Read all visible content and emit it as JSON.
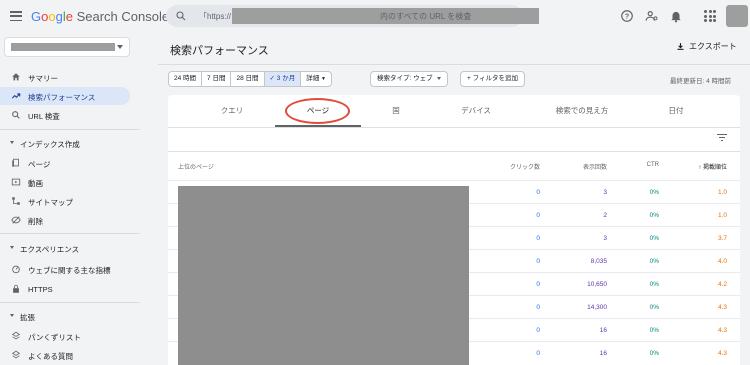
{
  "app": {
    "brand_google": "Google",
    "brand_product": "Search Console"
  },
  "search": {
    "prefix": "「https://",
    "suffix": "内のすべての URL を検査"
  },
  "sidebar": {
    "items": [
      {
        "label": "サマリー",
        "icon": "home-icon"
      },
      {
        "label": "検索パフォーマンス",
        "icon": "trending-icon",
        "active": true
      },
      {
        "label": "URL 検査",
        "icon": "search-icon"
      }
    ],
    "section_index": {
      "title": "インデックス作成",
      "items": [
        {
          "label": "ページ",
          "icon": "pages-icon"
        },
        {
          "label": "動画",
          "icon": "video-icon"
        },
        {
          "label": "サイトマップ",
          "icon": "sitemap-icon"
        },
        {
          "label": "削除",
          "icon": "removal-icon"
        }
      ]
    },
    "section_experience": {
      "title": "エクスペリエンス",
      "items": [
        {
          "label": "ウェブに関する主な指標",
          "icon": "vitals-icon"
        },
        {
          "label": "HTTPS",
          "icon": "lock-icon"
        }
      ]
    },
    "section_enhancements": {
      "title": "拡張",
      "items": [
        {
          "label": "パンくずリスト",
          "icon": "breadcrumb-icon"
        },
        {
          "label": "よくある質問",
          "icon": "faq-icon"
        }
      ]
    }
  },
  "main": {
    "title": "検索パフォーマンス",
    "export_label": "エクスポート",
    "date_options": [
      "24 時間",
      "7 日間",
      "28 日間",
      "3 か月",
      "詳細"
    ],
    "selected_date": "3 か月",
    "search_type_label": "検索タイプ: ウェブ",
    "add_filter_label": "+ フィルタを追加",
    "last_updated": "最終更新日: 4 時間前",
    "tabs": [
      "クエリ",
      "ページ",
      "国",
      "デバイス",
      "検索での見え方",
      "日付"
    ],
    "active_tab": "ページ",
    "table": {
      "headers": {
        "page": "上位のページ",
        "clicks": "クリック数",
        "impressions": "表示回数",
        "ctr": "CTR",
        "position": "掲載順位"
      },
      "sort_column": "掲載順位",
      "rows": [
        {
          "clicks": "0",
          "impressions": "3",
          "ctr": "0%",
          "position": "1.0"
        },
        {
          "clicks": "0",
          "impressions": "2",
          "ctr": "0%",
          "position": "1.0"
        },
        {
          "clicks": "0",
          "impressions": "3",
          "ctr": "0%",
          "position": "3.7"
        },
        {
          "clicks": "0",
          "impressions": "8,035",
          "ctr": "0%",
          "position": "4.0"
        },
        {
          "clicks": "0",
          "impressions": "10,650",
          "ctr": "0%",
          "position": "4.2"
        },
        {
          "clicks": "0",
          "impressions": "14,300",
          "ctr": "0%",
          "position": "4.3"
        },
        {
          "clicks": "0",
          "impressions": "16",
          "ctr": "0%",
          "position": "4.3"
        },
        {
          "clicks": "0",
          "impressions": "16",
          "ctr": "0%",
          "position": "4.3"
        }
      ]
    }
  },
  "colors": {
    "clicks": "#1a73e8",
    "impressions": "#5e35b1",
    "ctr": "#00897b",
    "position": "#e8710a",
    "active_nav": "#dbe6f8",
    "highlight_circle": "#e04b3a"
  }
}
